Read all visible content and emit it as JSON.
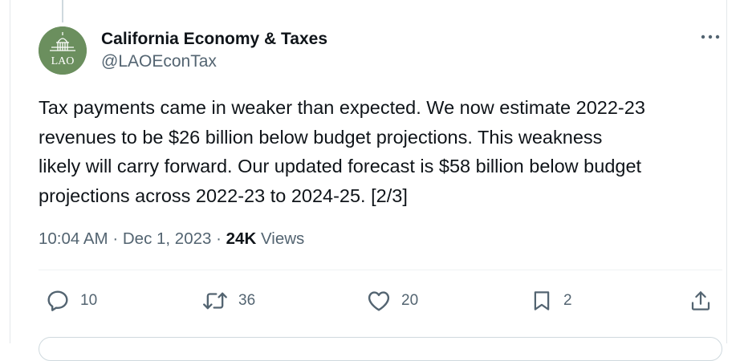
{
  "colors": {
    "avatar_bg": "#6b8f5e",
    "text_primary": "#0f1419",
    "text_secondary": "#536471",
    "border": "#e4e8eb"
  },
  "tweet": {
    "author": {
      "display_name": "California Economy & Taxes",
      "handle": "@LAOEconTax",
      "avatar_text": "LAO",
      "avatar_icon": "capitol-dome-icon"
    },
    "text": "Tax payments came in weaker than expected. We now estimate 2022-23\nrevenues to be $26 billion below budget projections. This weakness\nlikely will carry forward. Our updated forecast is $58 billion below budget\nprojections across 2022-23 to 2024-25. [2/3]",
    "time": "10:04 AM",
    "separator": "·",
    "date": "Dec 1, 2023",
    "views_count": "24K",
    "views_label": "Views",
    "more_icon": "more-dots-icon",
    "actions": {
      "reply": {
        "icon": "reply-icon",
        "count": "10"
      },
      "retweet": {
        "icon": "retweet-icon",
        "count": "36"
      },
      "like": {
        "icon": "heart-icon",
        "count": "20"
      },
      "bookmark": {
        "icon": "bookmark-icon",
        "count": "2"
      },
      "share": {
        "icon": "share-icon"
      }
    }
  }
}
